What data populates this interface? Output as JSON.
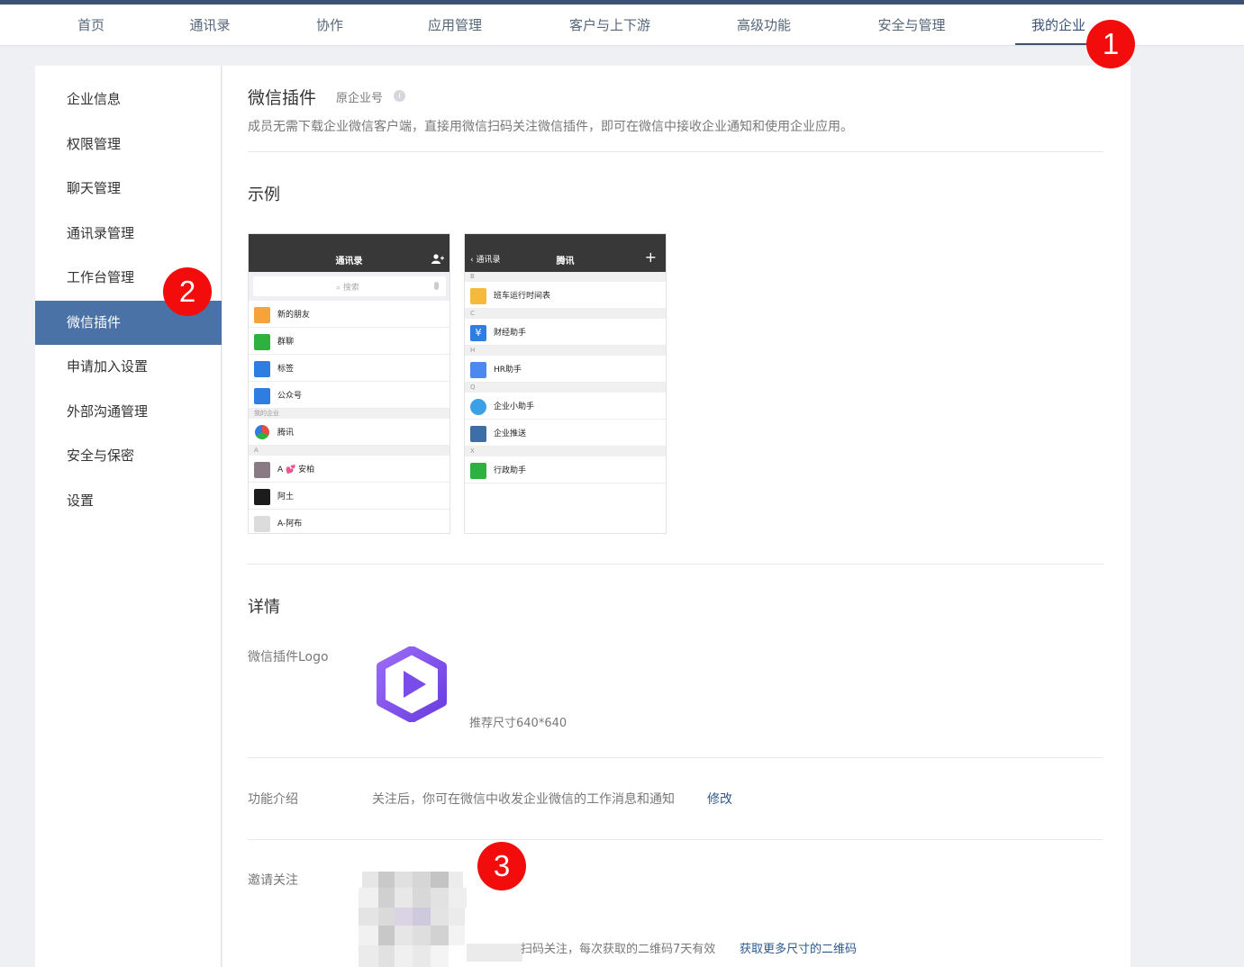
{
  "nav": {
    "tabs": [
      "首页",
      "通讯录",
      "协作",
      "应用管理",
      "客户与上下游",
      "高级功能",
      "安全与管理",
      "我的企业"
    ],
    "active": "我的企业"
  },
  "sidebar": {
    "items": [
      "企业信息",
      "权限管理",
      "聊天管理",
      "通讯录管理",
      "工作台管理",
      "微信插件",
      "申请加入设置",
      "外部沟通管理",
      "安全与保密",
      "设置"
    ],
    "active": "微信插件"
  },
  "badges": [
    "1",
    "2",
    "3"
  ],
  "header": {
    "title": "微信插件",
    "subtitle": "原企业号",
    "info_icon": "info-icon",
    "description": "成员无需下载企业微信客户端，直接用微信扫码关注微信插件，即可在微信中接收企业通知和使用企业应用。"
  },
  "example": {
    "heading": "示例",
    "phone1": {
      "title": "通讯录",
      "search": "搜索",
      "rows": [
        "新的朋友",
        "群聊",
        "标签",
        "公众号"
      ],
      "section_company": "我的企业",
      "company": "腾讯",
      "section_a": "A",
      "contacts": [
        "A 💕 安柏",
        "阿土",
        "A-阿布"
      ]
    },
    "phone2": {
      "back": "通讯录",
      "title": "腾讯",
      "sections": [
        "B",
        "C",
        "H",
        "Q",
        "X"
      ],
      "rows": [
        "班车运行时间表",
        "财经助手",
        "HR助手",
        "企业小助手",
        "企业推送",
        "行政助手"
      ]
    }
  },
  "details": {
    "heading": "详情",
    "logo_label": "微信插件Logo",
    "logo_hint": "推荐尺寸640*640",
    "intro_label": "功能介绍",
    "intro_text": "关注后，你可在微信中收发企业微信的工作消息和通知",
    "intro_edit": "修改",
    "invite_label": "邀请关注",
    "invite_text": "扫码关注，每次获取的二维码7天有效",
    "invite_link": "获取更多尺寸的二维码"
  },
  "colors": {
    "accent": "#3c5274",
    "sidebar_active": "#4a72a6",
    "badge": "#f20c0c",
    "link": "#2b5a8e",
    "logo": "#7b5cf0"
  }
}
